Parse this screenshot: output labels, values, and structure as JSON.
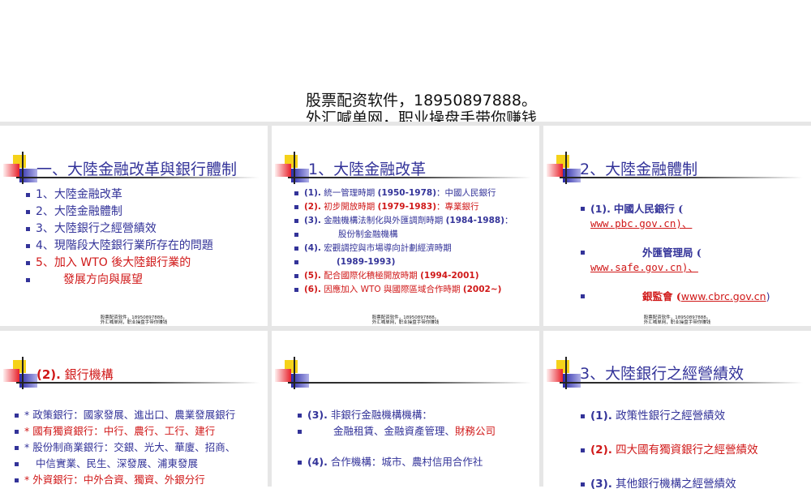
{
  "headline": {
    "line1": "股票配资软件，18950897888。",
    "line2": "外汇喊单网，职业操盘手带你赚钱"
  },
  "footer": {
    "line1": "股票配资软件，18950897888。",
    "line2": "外汇喊单网，职业操盘手带你赚钱"
  },
  "colors": {
    "blue": "#333399",
    "red": "#d01818"
  },
  "slides": [
    {
      "title": "一、大陸金融改革與銀行體制",
      "items": [
        "1、大陸金融改革",
        "2、大陸金融體制",
        "3、大陸銀行之經營績效",
        "4、現階段大陸銀行業所存在的問題",
        "5、加入 WTO 後大陸銀行業的",
        "發展方向與展望"
      ]
    },
    {
      "title": "1、大陸金融改革",
      "items": [
        {
          "num": "(1).",
          "text": "統一管理時期 ",
          "years": "(1950-1978)",
          "tail": "：中國人民銀行"
        },
        {
          "num": "(2).",
          "text": "初步開放時期 ",
          "years": "(1979-1983)",
          "tail": "：專業銀行"
        },
        {
          "num": "(3).",
          "text": "金融機構法制化與外匯調劑時期 ",
          "years": "(1984-1988)",
          "tail": "："
        },
        {
          "num": "",
          "text": "股份制金融機構",
          "years": "",
          "tail": ""
        },
        {
          "num": "(4).",
          "text": "宏觀調控與市場導向計劃經濟時期",
          "years": "",
          "tail": ""
        },
        {
          "num": "",
          "text": "",
          "years": "(1989-1993)",
          "tail": ""
        },
        {
          "num": "(5).",
          "text": "配合國際化積極開放時期 ",
          "years": "(1994-2001)",
          "tail": ""
        },
        {
          "num": "(6).",
          "text": "因應加入 WTO 與國際區域合作時期 ",
          "years": "(2002~)",
          "tail": ""
        }
      ]
    },
    {
      "title": "2、大陸金融體制",
      "items": [
        {
          "num": "(1).",
          "text": "中國人民銀行 (",
          "link": "www.pbc.gov.cn)、"
        },
        {
          "text": "外匯管理局 (",
          "link": "www.safe.gov.cn)、"
        },
        {
          "text": "銀監會 (",
          "link": "www.cbrc.gov.cn",
          "tail": ")"
        }
      ]
    },
    {
      "title_num": "(2).",
      "title": "銀行機構",
      "items": [
        "* 政策銀行：國家發展、進出口、農業發展銀行",
        "* 國有獨資銀行：中行、農行、工行、建行",
        "* 股份制商業銀行：交銀、光大、華廈、招商、",
        "中信實業、民生、深發展、浦東發展",
        "* 外資銀行：中外合資、獨資、外銀分行"
      ]
    },
    {
      "title": "",
      "items": [
        {
          "num": "(3).",
          "text": "非銀行金融機構機構："
        },
        {
          "text": "金融租賃、金融資產管理、",
          "red": "財務公司"
        },
        {
          "num": "(4).",
          "text": "合作機構：城市、農村信用合作社"
        }
      ]
    },
    {
      "title": "3、大陸銀行之經營績效",
      "items": [
        {
          "num": "(1).",
          "text": "政策性銀行之經營績效"
        },
        {
          "num": "(2).",
          "text": "四大國有獨資銀行之經營績效"
        },
        {
          "num": "(3).",
          "text": "其他銀行機構之經營績效"
        }
      ]
    }
  ]
}
